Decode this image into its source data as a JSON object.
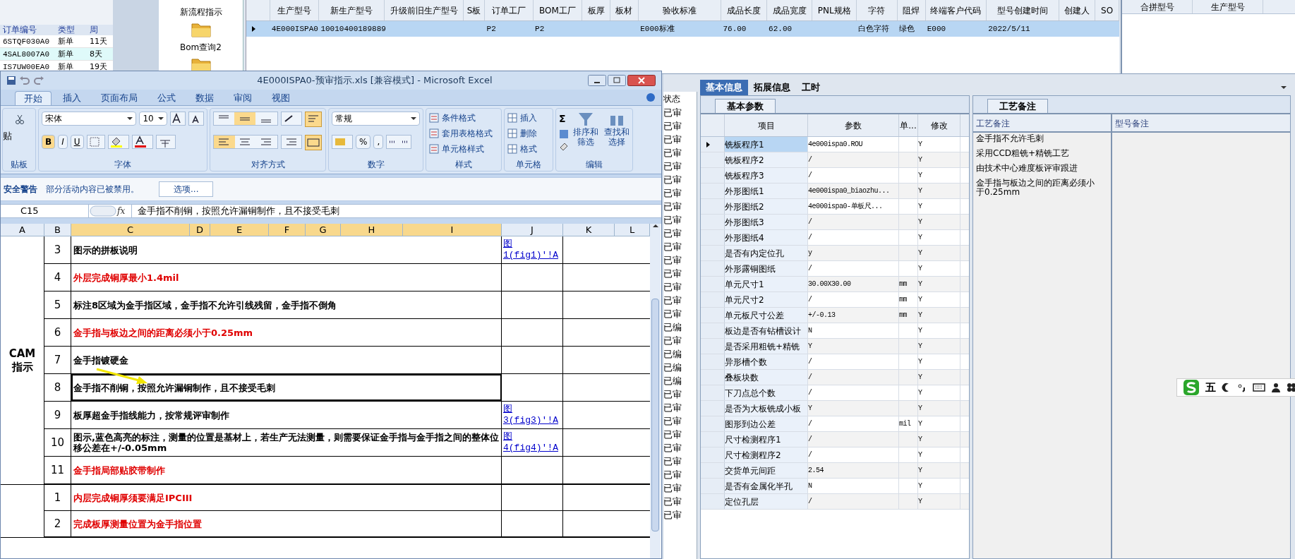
{
  "order_list": {
    "columns": [
      "订单编号",
      "类型",
      "周"
    ],
    "rows": [
      {
        "cells": [
          "6STQF030A0",
          "新单",
          "11天"
        ],
        "selected": false
      },
      {
        "cells": [
          "4SAL8007A0",
          "新单",
          "8天"
        ],
        "selected": true
      },
      {
        "cells": [
          "IS7UW00EA0",
          "新单",
          "19天"
        ],
        "selected": false
      }
    ]
  },
  "tree": {
    "items": [
      "新流程指示",
      "Bom查询2"
    ]
  },
  "product_grid": {
    "columns": [
      "生产型号",
      "新生产型号",
      "升级前旧生产型号",
      "S板",
      "订单工厂",
      "BOM工厂",
      "板厚",
      "板材",
      "验收标准",
      "成品长度",
      "成品宽度",
      "PNL规格",
      "字符",
      "阻焊",
      "终端客户代码",
      "型号创建时间",
      "创建人",
      "SO"
    ],
    "rows": [
      {
        "cells": [
          "4E000ISPA0",
          "10010400189889",
          "",
          "",
          "P2",
          "P2",
          "",
          "",
          "E000标准",
          "76.00",
          "62.00",
          "",
          "白色字符",
          "绿色",
          "E000",
          "2022/5/11",
          "",
          ""
        ],
        "selected": true
      }
    ]
  },
  "merge_grid": {
    "columns": [
      "合拼型号",
      "生产型号"
    ]
  },
  "detail_tabs": [
    {
      "label": "基本信息",
      "selected": true
    },
    {
      "label": "拓展信息",
      "selected": false
    },
    {
      "label": "工时",
      "selected": false
    }
  ],
  "status_list": {
    "header": "状态",
    "items": [
      "已审",
      "已审",
      "已审",
      "已审",
      "已审",
      "已审",
      "已审",
      "已审",
      "已审",
      "已审",
      "已审",
      "已审",
      "已审",
      "已审",
      "已审",
      "已审",
      "已编",
      "已审",
      "已编",
      "已编",
      "已编",
      "已审",
      "已审",
      "已审",
      "已审",
      "已审",
      "已审",
      "已审",
      "已审",
      "已审",
      "已审"
    ]
  },
  "params": {
    "tab": "基本参数",
    "columns": [
      "项目",
      "参数",
      "单...",
      "修改"
    ],
    "rows": [
      {
        "cells": [
          "铣板程序1",
          "4e000ispa0.ROU",
          "",
          "Y"
        ],
        "selected": true
      },
      {
        "cells": [
          "铣板程序2",
          "/",
          "",
          "Y"
        ],
        "selected": false
      },
      {
        "cells": [
          "铣板程序3",
          "/",
          "",
          "Y"
        ],
        "selected": false
      },
      {
        "cells": [
          "外形图纸1",
          "4e000ispa0_biaozhu...",
          "",
          "Y"
        ],
        "selected": false
      },
      {
        "cells": [
          "外形图纸2",
          "4e000ispa0-单板尺...",
          "",
          "Y"
        ],
        "selected": false
      },
      {
        "cells": [
          "外形图纸3",
          "/",
          "",
          "Y"
        ],
        "selected": false
      },
      {
        "cells": [
          "外形图纸4",
          "/",
          "",
          "Y"
        ],
        "selected": false
      },
      {
        "cells": [
          "是否有内定位孔",
          "y",
          "",
          "Y"
        ],
        "selected": false
      },
      {
        "cells": [
          "外形露铜图纸",
          "/",
          "",
          "Y"
        ],
        "selected": false
      },
      {
        "cells": [
          "单元尺寸1",
          "30.00X30.00",
          "mm",
          "Y"
        ],
        "selected": false
      },
      {
        "cells": [
          "单元尺寸2",
          "/",
          "mm",
          "Y"
        ],
        "selected": false
      },
      {
        "cells": [
          "单元板尺寸公差",
          "+/-0.13",
          "mm",
          "Y"
        ],
        "selected": false
      },
      {
        "cells": [
          "板边是否有钻槽设计",
          "N",
          "",
          "Y"
        ],
        "selected": false
      },
      {
        "cells": [
          "是否采用粗铣+精铣",
          "Y",
          "",
          "Y"
        ],
        "selected": false
      },
      {
        "cells": [
          "异形槽个数",
          "/",
          "",
          "Y"
        ],
        "selected": false
      },
      {
        "cells": [
          "叠板块数",
          "/",
          "",
          "Y"
        ],
        "selected": false
      },
      {
        "cells": [
          "下刀点总个数",
          "/",
          "",
          "Y"
        ],
        "selected": false
      },
      {
        "cells": [
          "是否为大板铣成小板",
          "Y",
          "",
          "Y"
        ],
        "selected": false
      },
      {
        "cells": [
          "图形到边公差",
          "/",
          "mil",
          "Y"
        ],
        "selected": false
      },
      {
        "cells": [
          "尺寸检测程序1",
          "/",
          "",
          "Y"
        ],
        "selected": false
      },
      {
        "cells": [
          "尺寸检测程序2",
          "/",
          "",
          "Y"
        ],
        "selected": false
      },
      {
        "cells": [
          "交货单元间距",
          "2.54",
          "",
          "Y"
        ],
        "selected": false
      },
      {
        "cells": [
          "是否有金属化半孔",
          "N",
          "",
          "Y"
        ],
        "selected": false
      },
      {
        "cells": [
          "定位孔层",
          "/",
          "",
          "Y"
        ],
        "selected": false
      }
    ]
  },
  "notes": {
    "tab": "工艺备注",
    "columns": [
      "工艺备注",
      "型号备注"
    ],
    "lines": [
      "金手指不允许毛刺",
      "采用CCD粗铣+精铣工艺",
      "由技术中心难度板评审跟进",
      "金手指与板边之间的距离必须小于0.25mm"
    ]
  },
  "ime_toolbar": {
    "mode": "五"
  },
  "excel": {
    "title": "4E000ISPA0-预审指示.xls  [兼容模式] - Microsoft Excel",
    "ribbon_tabs": [
      {
        "label": "开始",
        "selected": true
      },
      {
        "label": "插入",
        "selected": false
      },
      {
        "label": "页面布局",
        "selected": false
      },
      {
        "label": "公式",
        "selected": false
      },
      {
        "label": "数据",
        "selected": false
      },
      {
        "label": "审阅",
        "selected": false
      },
      {
        "label": "视图",
        "selected": false
      }
    ],
    "clipboard": {
      "paste": "贴",
      "label": "贴板"
    },
    "font": {
      "name": "宋体",
      "size": "10",
      "bold": "B",
      "italic": "I",
      "underline": "U",
      "label": "字体"
    },
    "alignment": {
      "label": "对齐方式"
    },
    "number": {
      "format": "常规",
      "percent": "%",
      "comma": ",",
      "label": "数字"
    },
    "styles": {
      "items": [
        "条件格式",
        "套用表格格式",
        "单元格样式"
      ],
      "label": "样式"
    },
    "cells": {
      "items": [
        "插入",
        "删除",
        "格式"
      ],
      "label": "单元格"
    },
    "editing": {
      "sum": "Σ",
      "items": [
        "排序和筛选",
        "查找和选择"
      ],
      "label": "编辑"
    },
    "security": {
      "title": "安全警告",
      "message": "部分活动内容已被禁用。",
      "button": "选项..."
    },
    "formula_bar": {
      "name_box": "C15",
      "fx": "fx",
      "content": "金手指不削铜，按照允许漏铜制作，且不接受毛刺"
    },
    "columns": [
      {
        "label": "A",
        "selected": false
      },
      {
        "label": "B",
        "selected": false
      },
      {
        "label": "C",
        "selected": true
      },
      {
        "label": "D",
        "selected": true
      },
      {
        "label": "E",
        "selected": true
      },
      {
        "label": "F",
        "selected": true
      },
      {
        "label": "G",
        "selected": true
      },
      {
        "label": "H",
        "selected": true
      },
      {
        "label": "I",
        "selected": true
      },
      {
        "label": "J",
        "selected": false
      },
      {
        "label": "K",
        "selected": false
      },
      {
        "label": "L",
        "selected": false
      }
    ],
    "groups": [
      {
        "label": [
          "CAM",
          "指示"
        ],
        "rows": [
          {
            "no": "3",
            "text": "图示的拼板说明",
            "emphasis": false,
            "link": "图1(fig1)'!A",
            "selected": false
          },
          {
            "no": "4",
            "text": "外层完成铜厚最小1.4mil",
            "emphasis": true,
            "link": "",
            "selected": false
          },
          {
            "no": "5",
            "text": "标注8区域为金手指区域，金手指不允许引线残留，金手指不倒角",
            "emphasis": false,
            "link": "",
            "selected": false
          },
          {
            "no": "6",
            "text": "金手指与板边之间的距离必须小于0.25mm",
            "emphasis": true,
            "link": "",
            "selected": false
          },
          {
            "no": "7",
            "text": "金手指镀硬金",
            "emphasis": false,
            "link": "",
            "selected": false
          },
          {
            "no": "8",
            "text": "金手指不削铜，按照允许漏铜制作，且不接受毛刺",
            "emphasis": false,
            "link": "",
            "selected": true
          },
          {
            "no": "9",
            "text": "板厚超金手指线能力，按常规评审制作",
            "emphasis": false,
            "link": "图3(fig3)'!A",
            "selected": false
          },
          {
            "no": "10",
            "text": "图示,蓝色高亮的标注，测量的位置是基材上，若生产无法测量，则需要保证金手指与金手指之间的整体位移公差在+/-0.05mm",
            "emphasis": false,
            "link": "图4(fig4)'!A",
            "selected": false
          },
          {
            "no": "11",
            "text": "金手指局部贴胶带制作",
            "emphasis": true,
            "link": "",
            "selected": false
          }
        ]
      },
      {
        "rows": [
          {
            "no": "1",
            "text": "内层完成铜厚须要满足IPCIII",
            "emphasis": true,
            "link": "",
            "selected": false
          },
          {
            "no": "2",
            "text": "完成板厚测量位置为金手指位置",
            "emphasis": true,
            "link": "",
            "selected": false
          }
        ]
      }
    ]
  }
}
